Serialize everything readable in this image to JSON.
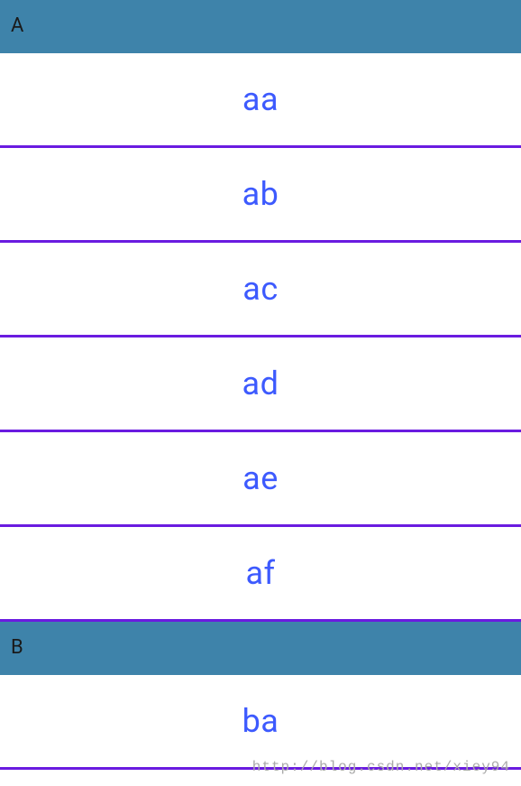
{
  "sections": [
    {
      "header": "A",
      "items": [
        "aa",
        "ab",
        "ac",
        "ad",
        "ae",
        "af"
      ]
    },
    {
      "header": "B",
      "items": [
        "ba"
      ]
    }
  ],
  "watermark": "http://blog.csdn.net/xiey94",
  "colors": {
    "header_bg": "#3e83aa",
    "item_text": "#3d5afe",
    "divider": "#6a1be0"
  }
}
